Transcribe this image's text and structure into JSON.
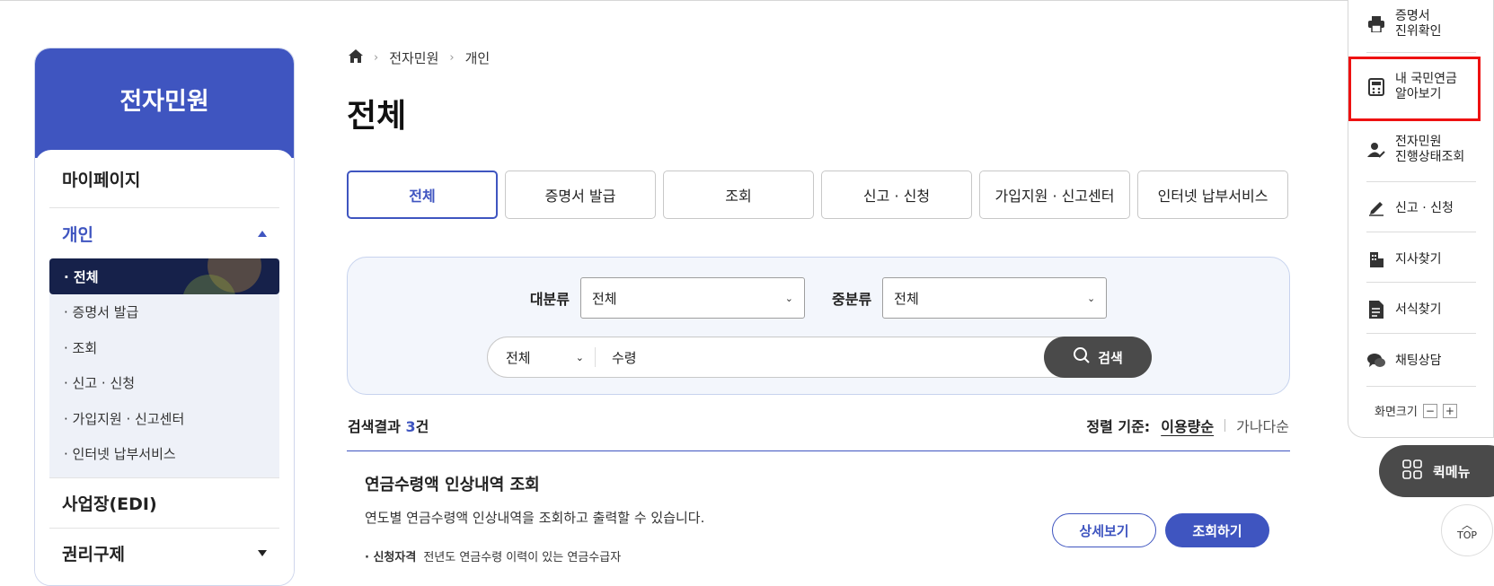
{
  "sidebar": {
    "title": "전자민원",
    "mypage": "마이페이지",
    "section_open": "개인",
    "sub_items": [
      {
        "label": "· 전체"
      },
      {
        "label": "· 증명서 발급"
      },
      {
        "label": "· 조회"
      },
      {
        "label": "· 신고 · 신청"
      },
      {
        "label": "· 가입지원 · 신고센터"
      },
      {
        "label": "· 인터넷 납부서비스"
      }
    ],
    "edi": "사업장(EDI)",
    "rights": "권리구제"
  },
  "breadcrumb": {
    "level1": "전자민원",
    "level2": "개인"
  },
  "page_title": "전체",
  "tabs": [
    {
      "label": "전체"
    },
    {
      "label": "증명서 발급"
    },
    {
      "label": "조회"
    },
    {
      "label": "신고 · 신청"
    },
    {
      "label": "가입지원 · 신고센터"
    },
    {
      "label": "인터넷 납부서비스"
    }
  ],
  "filters": {
    "major_label": "대분류",
    "major_value": "전체",
    "minor_label": "중분류",
    "minor_value": "전체"
  },
  "search": {
    "scope": "전체",
    "query": "수령",
    "button": "검색"
  },
  "results": {
    "count_prefix": "검색결과 ",
    "count": "3",
    "count_suffix": "건",
    "sort_label": "정렬 기준:",
    "sort_active": "이용량순",
    "sort_other": "가나다순"
  },
  "item": {
    "title": "연금수령액 인상내역 조회",
    "desc": "연도별 연금수령액 인상내역을 조회하고 출력할 수 있습니다.",
    "meta_label": "· 신청자격",
    "meta_value": "전년도 연금수령 이력이 있는 연금수급자",
    "detail_button": "상세보기",
    "query_button": "조회하기"
  },
  "quick_menu": {
    "items": [
      {
        "line1": "증명서",
        "line2": "진위확인",
        "icon": "printer-icon"
      },
      {
        "line1": "내 국민연금",
        "line2": "알아보기",
        "icon": "calculator-icon"
      },
      {
        "line1": "전자민원",
        "line2": "진행상태조회",
        "icon": "person-edit-icon"
      },
      {
        "line1": "신고 · 신청",
        "line2": "",
        "icon": "pencil-icon"
      },
      {
        "line1": "지사찾기",
        "line2": "",
        "icon": "building-icon"
      },
      {
        "line1": "서식찾기",
        "line2": "",
        "icon": "document-icon"
      },
      {
        "line1": "채팅상담",
        "line2": "",
        "icon": "chat-icon"
      }
    ],
    "size_label": "화면크기",
    "size_minus": "−",
    "size_plus": "+",
    "menu_button": "퀵메뉴",
    "top_button": "TOP"
  },
  "colors": {
    "brand": "#3f55c0",
    "dark": "#16214a",
    "highlight": "#e11111"
  }
}
